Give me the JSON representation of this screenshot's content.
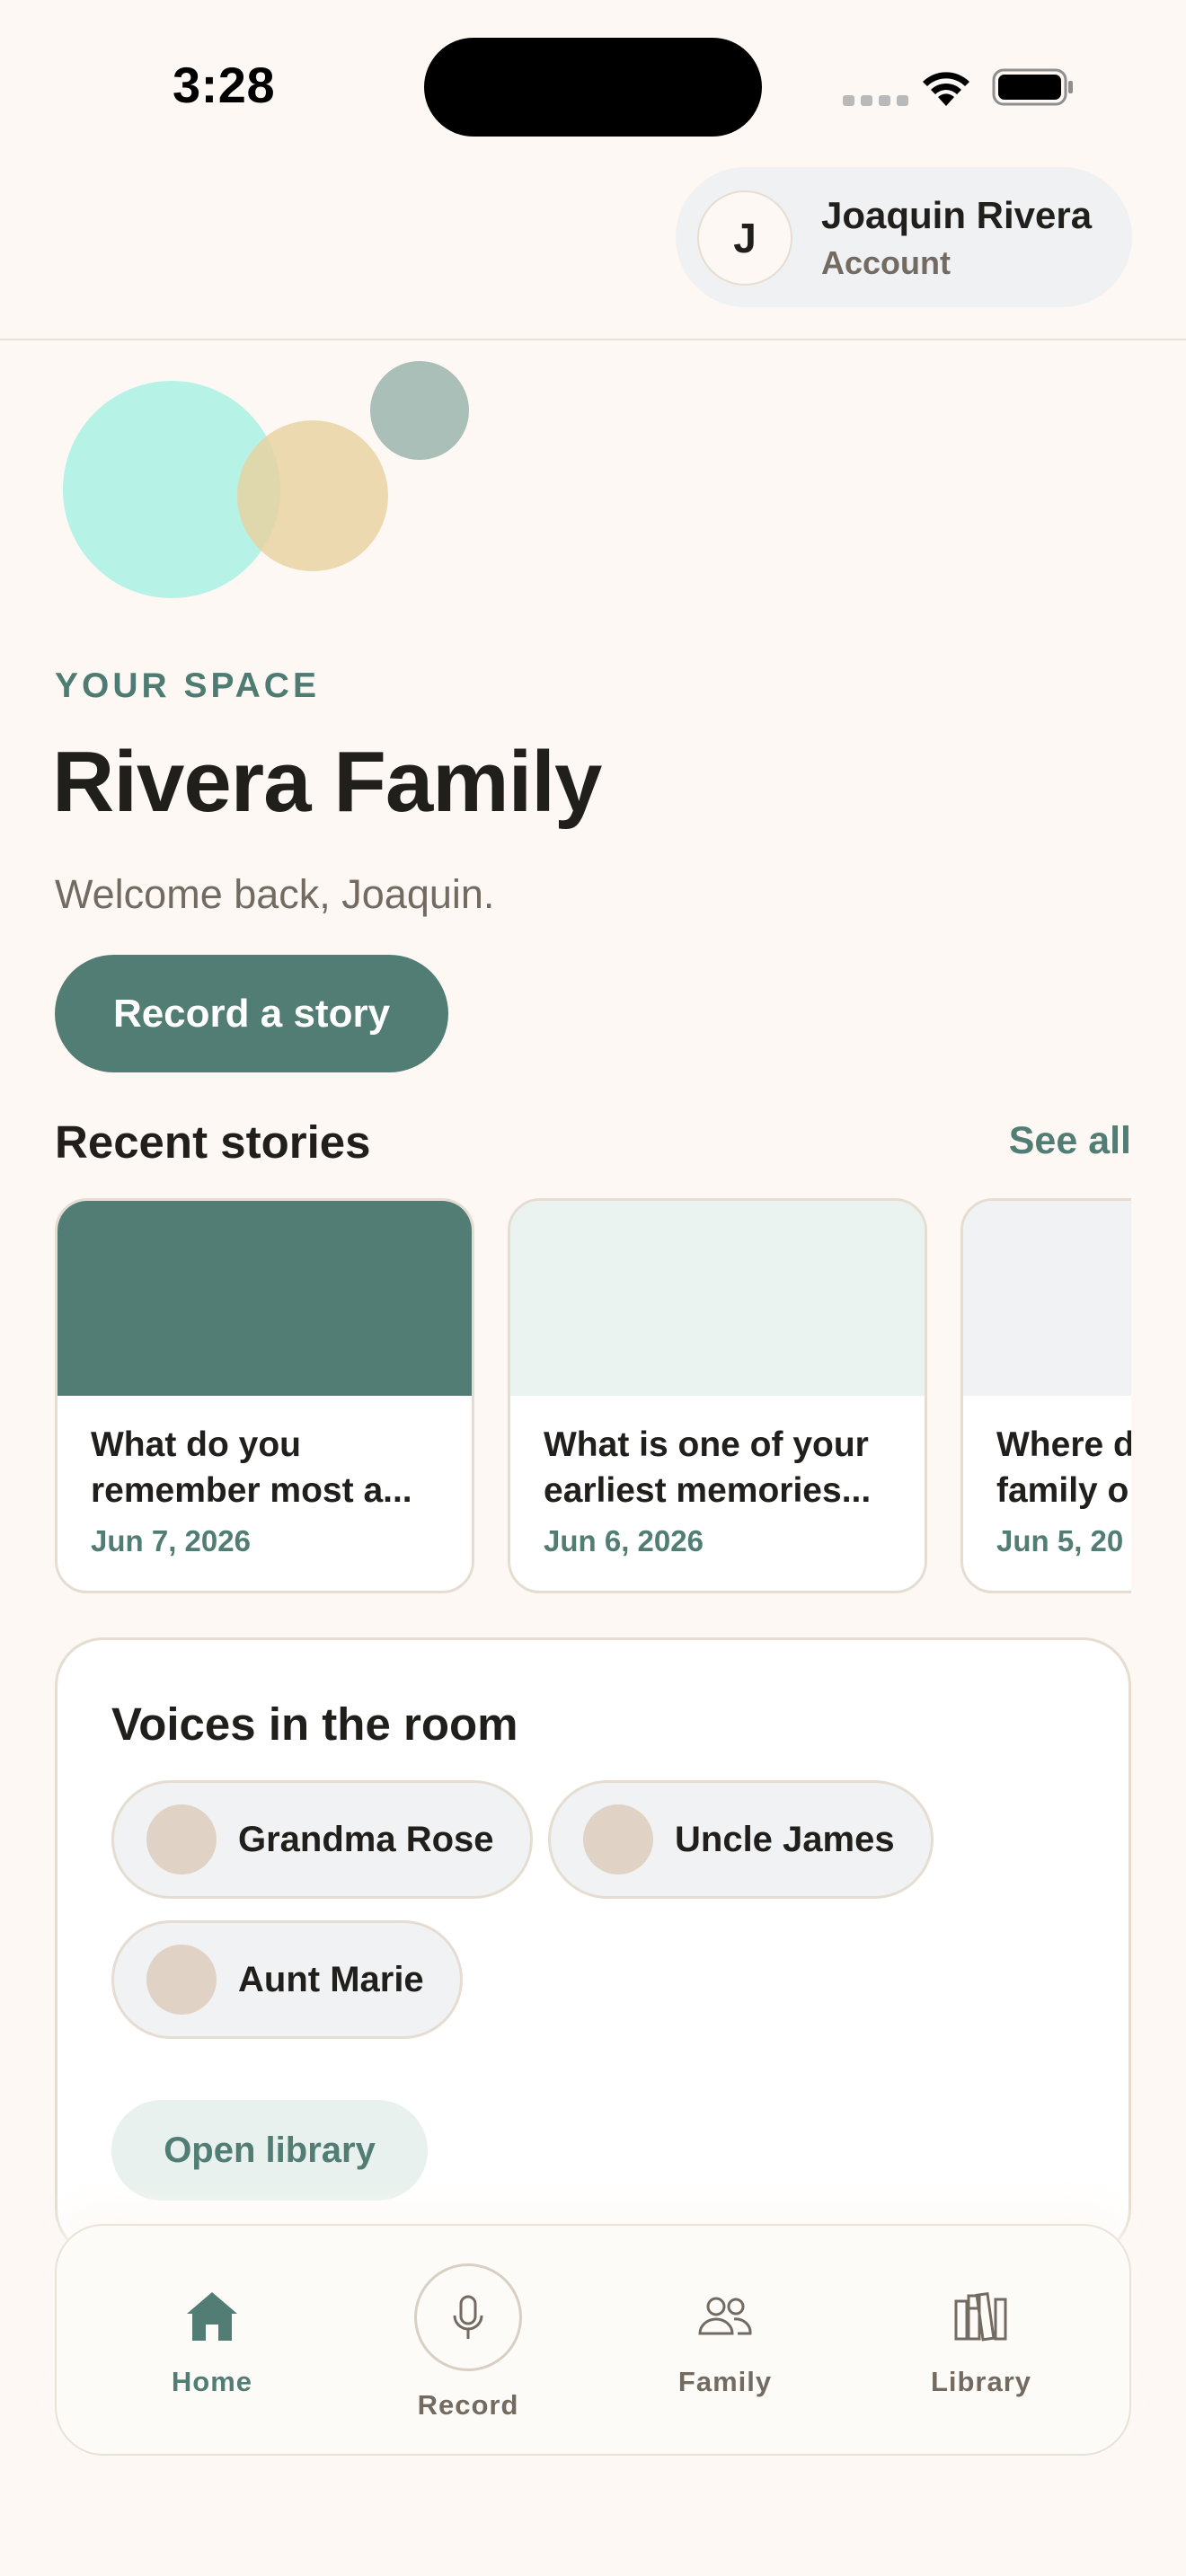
{
  "status_bar": {
    "time": "3:28"
  },
  "account": {
    "initial": "J",
    "name": "Joaquin Rivera",
    "subtitle": "Account"
  },
  "hero": {
    "eyebrow": "YOUR SPACE",
    "title": "Rivera Family",
    "welcome": "Welcome back, Joaquin.",
    "record_button": "Record a story"
  },
  "recent_stories": {
    "heading": "Recent stories",
    "see_all": "See all",
    "items": [
      {
        "title": "What do you\nremember most a...",
        "date": "Jun 7, 2026",
        "cover_color": "#517d74"
      },
      {
        "title": "What is one of your\nearliest memories...",
        "date": "Jun 6, 2026",
        "cover_color": "#eaf3ef"
      },
      {
        "title": "Where d\nfamily o",
        "date": "Jun 5, 20",
        "cover_color": "#f1f2f4"
      }
    ]
  },
  "voices": {
    "heading": "Voices in the room",
    "people": [
      {
        "name": "Grandma Rose"
      },
      {
        "name": "Uncle James"
      },
      {
        "name": "Aunt Marie"
      }
    ],
    "open_library": "Open library"
  },
  "tabbar": {
    "items": [
      {
        "label": "Home",
        "icon": "home-icon",
        "active": true
      },
      {
        "label": "Record",
        "icon": "microphone-icon",
        "active": false
      },
      {
        "label": "Family",
        "icon": "people-icon",
        "active": false
      },
      {
        "label": "Library",
        "icon": "books-icon",
        "active": false
      }
    ]
  },
  "colors": {
    "background": "#fdf8f4",
    "accent": "#517d74",
    "accent_soft": "#e8f1ee",
    "text": "#211f1c",
    "muted": "#736b61"
  }
}
